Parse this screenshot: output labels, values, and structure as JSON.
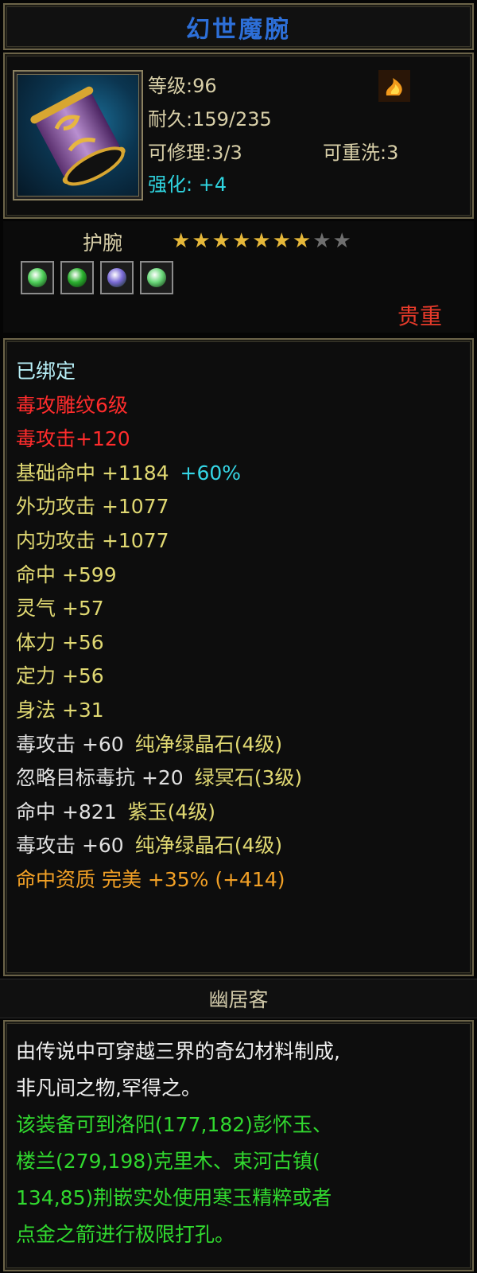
{
  "title": "幻世魔腕",
  "stats": {
    "level": "等级:96",
    "durability": "耐久:159/235",
    "repair": "可修理:3/3",
    "rewash": "可重洗:3",
    "enhance_label": "强化:",
    "enhance_value": "+4"
  },
  "type": "护腕",
  "stars": {
    "filled": 7,
    "total": 9
  },
  "gems": [
    {
      "icon": "green-gem-icon",
      "color": "#4fd05a"
    },
    {
      "icon": "green-crystal-icon",
      "color": "#2bb02f"
    },
    {
      "icon": "purple-gem-icon",
      "color": "#7a6ad6"
    },
    {
      "icon": "green-gem-icon",
      "color": "#6bd87a"
    }
  ],
  "rarity": "贵重",
  "attributes": [
    {
      "text": "已绑定",
      "color": "light"
    },
    {
      "text": "毒攻雕纹6级",
      "color": "red"
    },
    {
      "text": "毒攻击+120",
      "color": "red"
    },
    {
      "text": "基础命中 +1184",
      "color": "yellow",
      "extra": "+60%"
    },
    {
      "text": "外功攻击 +1077",
      "color": "yellow"
    },
    {
      "text": "内功攻击 +1077",
      "color": "yellow"
    },
    {
      "text": "命中 +599",
      "color": "yellow"
    },
    {
      "text": "灵气 +57",
      "color": "yellow"
    },
    {
      "text": "体力 +56",
      "color": "yellow"
    },
    {
      "text": "定力 +56",
      "color": "yellow"
    },
    {
      "text": "身法 +31",
      "color": "yellow"
    },
    {
      "text": "毒攻击 +60",
      "color": "white",
      "extra": "纯净绿晶石(4级)"
    },
    {
      "text": "忽略目标毒抗 +20",
      "color": "white",
      "extra": "绿冥石(3级)"
    },
    {
      "text": "命中 +821",
      "color": "white",
      "extra": "紫玉(4级)"
    },
    {
      "text": "毒攻击 +60",
      "color": "white",
      "extra": "纯净绿晶石(4级)"
    },
    {
      "text": "命中资质  完美 +35% (+414)",
      "color": "orange"
    }
  ],
  "maker": "幽居客",
  "description": [
    {
      "text": "由传说中可穿越三界的奇幻材料制成,",
      "color": "white"
    },
    {
      "text": "非凡间之物,罕得之。",
      "color": "white"
    },
    {
      "text": "该装备可到洛阳(177,182)彭怀玉、",
      "color": "green"
    },
    {
      "text": "楼兰(279,198)克里木、束河古镇(",
      "color": "green"
    },
    {
      "text": "134,85)荆嵌实处使用寒玉精粹或者",
      "color": "green"
    },
    {
      "text": "点金之箭进行极限打孔。",
      "color": "green"
    }
  ]
}
